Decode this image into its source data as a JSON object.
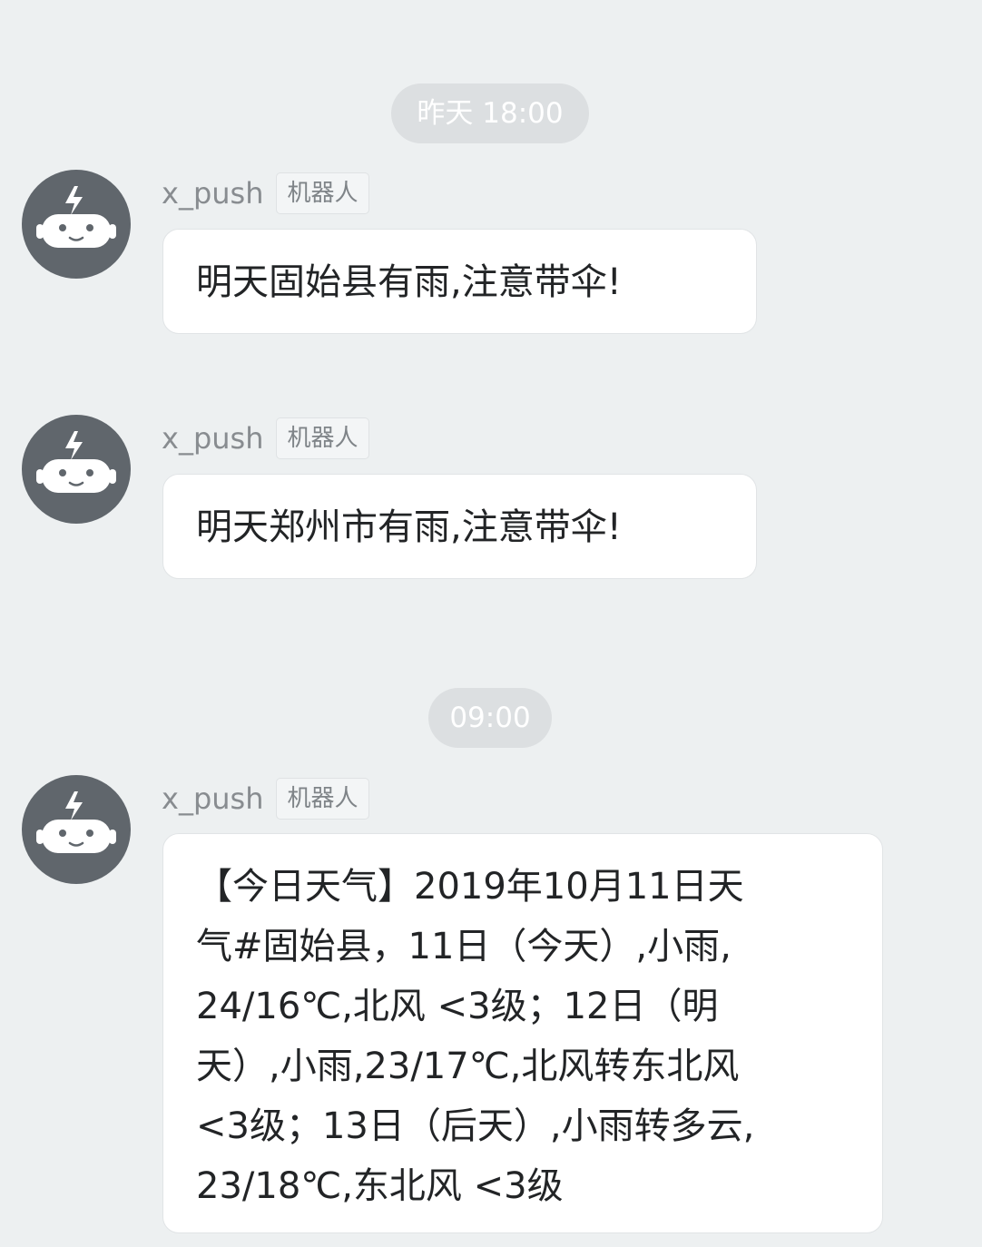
{
  "chat": {
    "timestamps": [
      "昨天 18:00",
      "09:00"
    ],
    "messages": [
      {
        "sender": "x_push",
        "badge": "机器人",
        "avatar_icon": "robot-icon",
        "text": "明天固始县有雨,注意带伞!"
      },
      {
        "sender": "x_push",
        "badge": "机器人",
        "avatar_icon": "robot-icon",
        "text": "明天郑州市有雨,注意带伞!"
      },
      {
        "sender": "x_push",
        "badge": "机器人",
        "avatar_icon": "robot-icon",
        "lines": [
          "【今日天气】2019年10月11日天",
          "气#固始县，11日（今天）,小雨,",
          "24/16℃,北风 <3级；12日（明",
          "天）,小雨,23/17℃,北风转东北风",
          "<3级；13日（后天）,小雨转多云,",
          "23/18℃,东北风 <3级"
        ]
      }
    ]
  },
  "colors": {
    "background": "#edf0f1",
    "avatar": "#60666c",
    "bubble": "#ffffff",
    "timestamp_pill": "#dcdfe1"
  }
}
